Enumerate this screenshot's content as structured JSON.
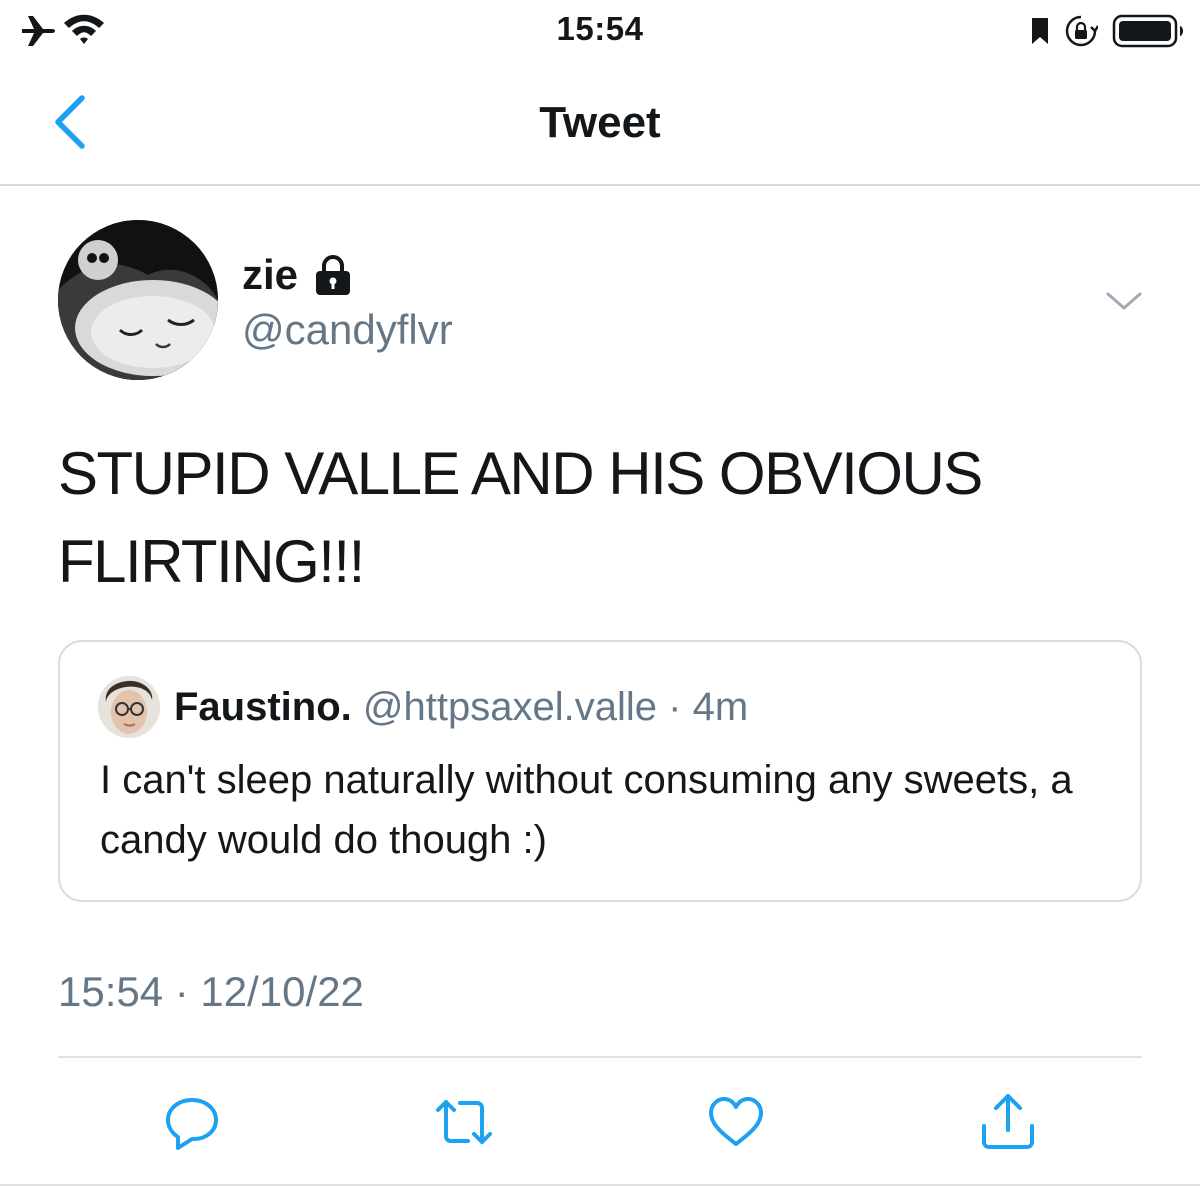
{
  "status_bar": {
    "time": "15:54",
    "left_icons": [
      "airplane-icon",
      "wifi-icon"
    ],
    "right_icons": [
      "bookmark-icon",
      "orientation-lock-icon",
      "battery-icon"
    ]
  },
  "nav": {
    "title": "Tweet",
    "back_icon": "chevron-left-icon",
    "accent_color": "#1da1f2"
  },
  "tweet": {
    "author_name": "zie",
    "author_handle": "@candyflvr",
    "protected_icon": "lock-icon",
    "menu_icon": "chevron-down-icon",
    "text": "STUPID VALLE AND HIS OBVIOUS\nFLIRTING!!!",
    "timestamp": "15:54 · 12/10/22"
  },
  "quoted_tweet": {
    "author_name": "Faustino.",
    "author_handle": "@httpsaxel.valle",
    "separator": "·",
    "time": "4m",
    "text": "I can't sleep naturally without consuming any sweets, a candy would do though :)"
  },
  "actions": [
    "reply-icon",
    "retweet-icon",
    "like-icon",
    "share-icon"
  ],
  "colors": {
    "text_primary": "#14171a",
    "text_secondary": "#657786",
    "divider": "#e1e1e1",
    "icon_blue": "#1da1f2"
  }
}
